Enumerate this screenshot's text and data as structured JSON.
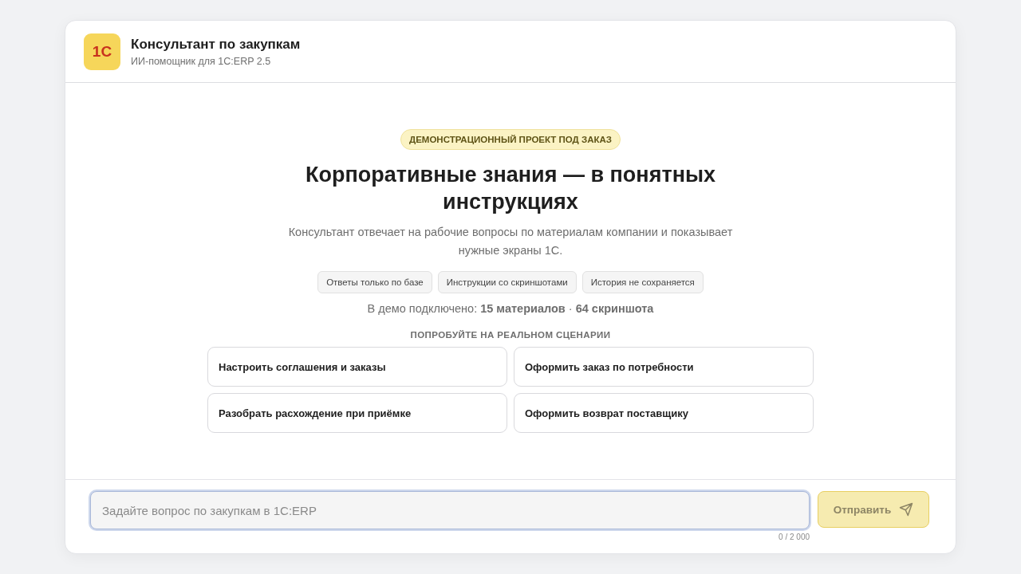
{
  "header": {
    "logo": "1С",
    "title": "Консультант по закупкам",
    "subtitle": "ИИ-помощник для 1С:ERP 2.5"
  },
  "intro": {
    "badge": "ДЕМОНСТРАЦИОННЫЙ ПРОЕКТ ПОД ЗАКАЗ",
    "heading": "Корпоративные знания — в понятных инструкциях",
    "description": "Консультант отвечает на рабочие вопросы по материалам компании и показывает нужные экраны 1С.",
    "features": [
      "Ответы только по базе",
      "Инструкции со скриншотами",
      "История не сохраняется"
    ],
    "stats": "В демо подключено: **15 материалов** · **64 скриншота**"
  },
  "scenarios": {
    "title": "ПОПРОБУЙТЕ НА РЕАЛЬНОМ СЦЕНАРИИ",
    "items": [
      "Настроить соглашения и заказы",
      "Оформить заказ по потребности",
      "Разобрать расхождение при приёмке",
      "Оформить возврат поставщику"
    ]
  },
  "composer": {
    "placeholder": "Задайте вопрос по закупкам в 1С:ERP",
    "focused": true,
    "counter": "0 / 2 000",
    "send": {
      "label": "Отправить",
      "disabled": true
    }
  }
}
